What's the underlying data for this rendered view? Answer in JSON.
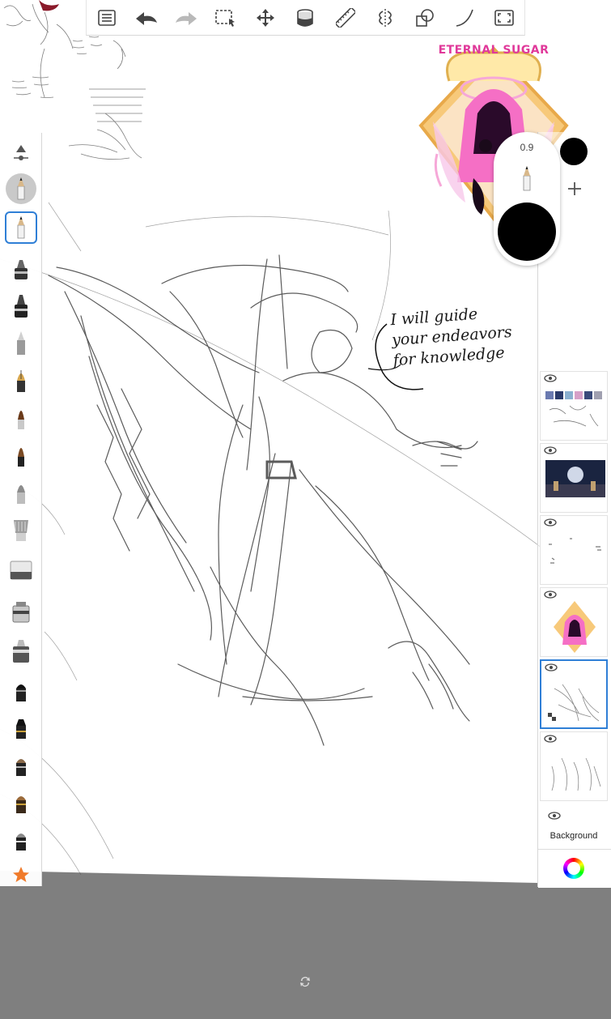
{
  "canvas": {
    "handwriting": [
      "I will guide",
      "your endeavors",
      "for knowledge"
    ],
    "sticker": {
      "title": "ETERNAL SUGAR"
    }
  },
  "toolbar": {
    "items": [
      {
        "name": "layer-list",
        "icon": "list-icon"
      },
      {
        "name": "undo",
        "icon": "undo-icon"
      },
      {
        "name": "redo",
        "icon": "redo-icon"
      },
      {
        "name": "selection",
        "icon": "selection-icon"
      },
      {
        "name": "transform",
        "icon": "move-icon"
      },
      {
        "name": "fill",
        "icon": "bucket-icon"
      },
      {
        "name": "ruler",
        "icon": "ruler-icon"
      },
      {
        "name": "symmetry",
        "icon": "symmetry-icon"
      },
      {
        "name": "shapes",
        "icon": "shapes-icon"
      },
      {
        "name": "curve",
        "icon": "curve-icon"
      },
      {
        "name": "fullscreen",
        "icon": "fullscreen-icon"
      }
    ]
  },
  "brush_panel": {
    "selected_index": 1,
    "brushes": [
      "pencil",
      "pencil",
      "marker",
      "ink-pen",
      "technical-pen",
      "fountain-pen",
      "paintbrush",
      "paintbrush",
      "airbrush",
      "flat-brush",
      "eraser",
      "smudge",
      "blender",
      "chisel",
      "chisel",
      "chisel",
      "chisel",
      "chisel",
      "chisel",
      "favorites"
    ],
    "favorites_icon": "star-icon"
  },
  "brush_puck": {
    "opacity_value": "0.9",
    "color": "#000000"
  },
  "layers": {
    "current_color": "#000000",
    "add_icon": "plus-icon",
    "items": [
      {
        "name": "layer-sketches",
        "selected": false
      },
      {
        "name": "layer-photo",
        "selected": false
      },
      {
        "name": "layer-marks",
        "selected": false
      },
      {
        "name": "layer-sticker",
        "selected": false
      },
      {
        "name": "layer-current-sketch",
        "selected": true
      },
      {
        "name": "layer-figures",
        "selected": false
      },
      {
        "name": "layer-background",
        "selected": false,
        "label": "Background"
      }
    ],
    "color_icon": "color-wheel-icon"
  },
  "accent_color": "#2f7fd6",
  "workspace_color": "#7f7f7f"
}
